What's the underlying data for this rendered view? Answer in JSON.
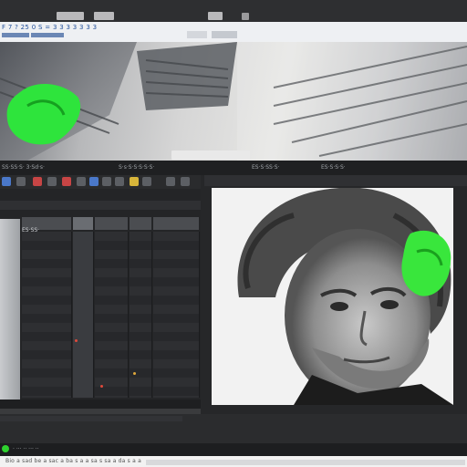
{
  "browser": {
    "address_text": "F 7 ? 25 0 S = 3 3 3 3 3 3 3",
    "tabs": [
      {
        "label": "",
        "color": "#b9b9bb"
      },
      {
        "label": "",
        "color": "#b9b9bb"
      },
      {
        "label": "",
        "color": "#b9b9bb"
      }
    ]
  },
  "hero": {
    "caption": ""
  },
  "strip": {
    "labels": [
      "SS·SS·S· 3·Sd·s·",
      "S·s·S·S·S·S·S·",
      "ES·S·SS·S·",
      "ES·S·S·S·"
    ]
  },
  "editor": {
    "track_label": "ES·SS·",
    "icons": [
      "icon-a",
      "icon-b",
      "icon-c",
      "icon-d",
      "icon-e",
      "icon-f",
      "icon-g",
      "icon-h",
      "icon-i",
      "icon-j",
      "icon-k",
      "icon-l",
      "icon-m"
    ]
  },
  "status": {
    "text": "· ··· ·· ··· ··"
  },
  "footer": {
    "text": "Bio a sad be a sac a ba s a a sa s sa a da s a a"
  },
  "colors": {
    "accent_green": "#2ed22e",
    "window_dark": "#2e2f31",
    "editor_bg": "#242527"
  }
}
